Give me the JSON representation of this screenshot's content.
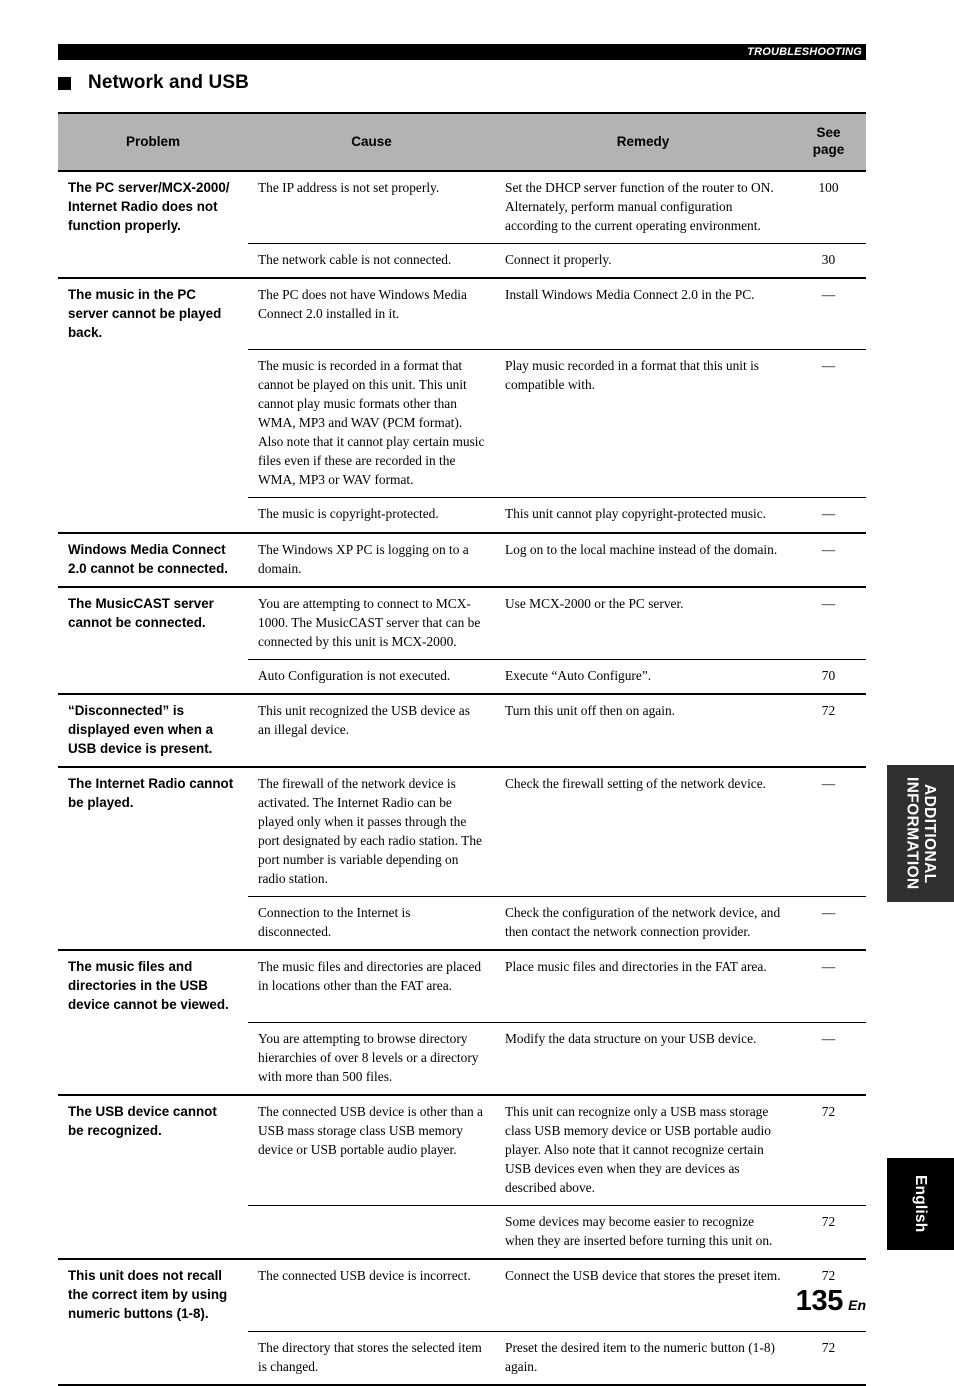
{
  "running_head": "TROUBLESHOOTING",
  "section": {
    "bullet": "square-bullet",
    "title": "Network and USB"
  },
  "table": {
    "headers": {
      "problem": "Problem",
      "cause": "Cause",
      "remedy": "Remedy",
      "see_page": "See\npage"
    },
    "rows": [
      {
        "problem": "The PC server/MCX-2000/\nInternet Radio does not\nfunction properly.",
        "cause": "The IP address is not set properly.",
        "remedy": "Set the DHCP server function of the router to ON. Alternately, perform manual configuration according to the current operating environment.",
        "page": "100",
        "group_start": true
      },
      {
        "problem": "",
        "cause": "The network cable is not connected.",
        "remedy": "Connect it properly.",
        "page": "30",
        "group_start": false
      },
      {
        "problem": "The music in the PC\nserver cannot be played\nback.",
        "cause": "The PC does not have Windows Media Connect 2.0 installed in it.",
        "remedy": "Install Windows Media Connect 2.0 in the PC.",
        "page": "—",
        "group_start": true
      },
      {
        "problem": "",
        "cause": "The music is recorded in a format that cannot be played on this unit. This unit cannot play music formats other than WMA, MP3 and WAV (PCM format). Also note that it cannot play certain music files even if these are recorded in the WMA, MP3 or WAV format.",
        "remedy": "Play music recorded in a format that this unit is compatible with.",
        "page": "—",
        "group_start": false
      },
      {
        "problem": "",
        "cause": "The music is copyright-protected.",
        "remedy": "This unit cannot play copyright-protected music.",
        "page": "—",
        "group_start": false
      },
      {
        "problem": "Windows Media Connect\n2.0 cannot be connected.",
        "cause": "The Windows XP PC is logging on to a domain.",
        "remedy": "Log on to the local machine instead of the domain.",
        "page": "—",
        "group_start": true
      },
      {
        "problem": "The MusicCAST server\ncannot be connected.",
        "cause": "You are attempting to connect to MCX-1000. The MusicCAST server that can be connected by this unit is MCX-2000.",
        "remedy": "Use MCX-2000 or the PC server.",
        "page": "—",
        "group_start": true
      },
      {
        "problem": "",
        "cause": "Auto Configuration is not executed.",
        "remedy": "Execute “Auto Configure”.",
        "page": "70",
        "group_start": false
      },
      {
        "problem": "“Disconnected” is\ndisplayed even when a\nUSB device is present.",
        "cause": "This unit recognized the USB device as an illegal device.",
        "remedy": "Turn this unit off then on again.",
        "page": "72",
        "group_start": true
      },
      {
        "problem": "The Internet Radio cannot\nbe played.",
        "cause": "The firewall of the network device is activated. The Internet Radio can be played only when it passes through the port designated by each radio station. The port number is variable depending on radio station.",
        "remedy": "Check the firewall setting of the network device.",
        "page": "—",
        "group_start": true
      },
      {
        "problem": "",
        "cause": "Connection to the Internet is disconnected.",
        "remedy": "Check the configuration of the network device, and then contact the network connection provider.",
        "page": "—",
        "group_start": false
      },
      {
        "problem": "The music files and\ndirectories in the USB\ndevice cannot be viewed.",
        "cause": "The music files and directories are placed in locations other than the FAT area.",
        "remedy": "Place music files and directories in the FAT area.",
        "page": "—",
        "group_start": true
      },
      {
        "problem": "",
        "cause": "You are attempting to browse directory hierarchies of over 8 levels or a directory with more than 500 files.",
        "remedy": "Modify the data structure on your USB device.",
        "page": "—",
        "group_start": false
      },
      {
        "problem": "The USB device cannot\nbe recognized.",
        "cause": "The connected USB device is other than a USB mass storage class USB memory device or USB portable audio player.",
        "remedy": "This unit can recognize only a USB mass storage class USB memory device or USB portable audio player. Also note that it cannot recognize certain USB devices even when they are devices as described above.",
        "page": "72",
        "group_start": true
      },
      {
        "problem": "",
        "cause": "",
        "remedy": "Some devices may become easier to recognize when they are inserted before turning this unit on.",
        "page": "72",
        "group_start": false
      },
      {
        "problem": "This unit does not recall\nthe correct item by using\nnumeric buttons (1-8).",
        "cause": "The connected USB device is incorrect.",
        "remedy": "Connect the USB device that stores the preset item.",
        "page": "72",
        "group_start": true
      },
      {
        "problem": "",
        "cause": "The directory that stores the selected item is changed.",
        "remedy": "Preset the desired item to the numeric button (1-8) again.",
        "page": "72",
        "group_start": false
      }
    ]
  },
  "side_tabs": {
    "additional_information": "ADDITIONAL\nINFORMATION",
    "english": "English"
  },
  "footer": {
    "page_number": "135",
    "page_suffix": "En"
  },
  "colors": {
    "header_fill": "#b3b3b3",
    "runhead_bar": "#000000",
    "tab_additional": "#303030",
    "tab_english": "#000000"
  }
}
